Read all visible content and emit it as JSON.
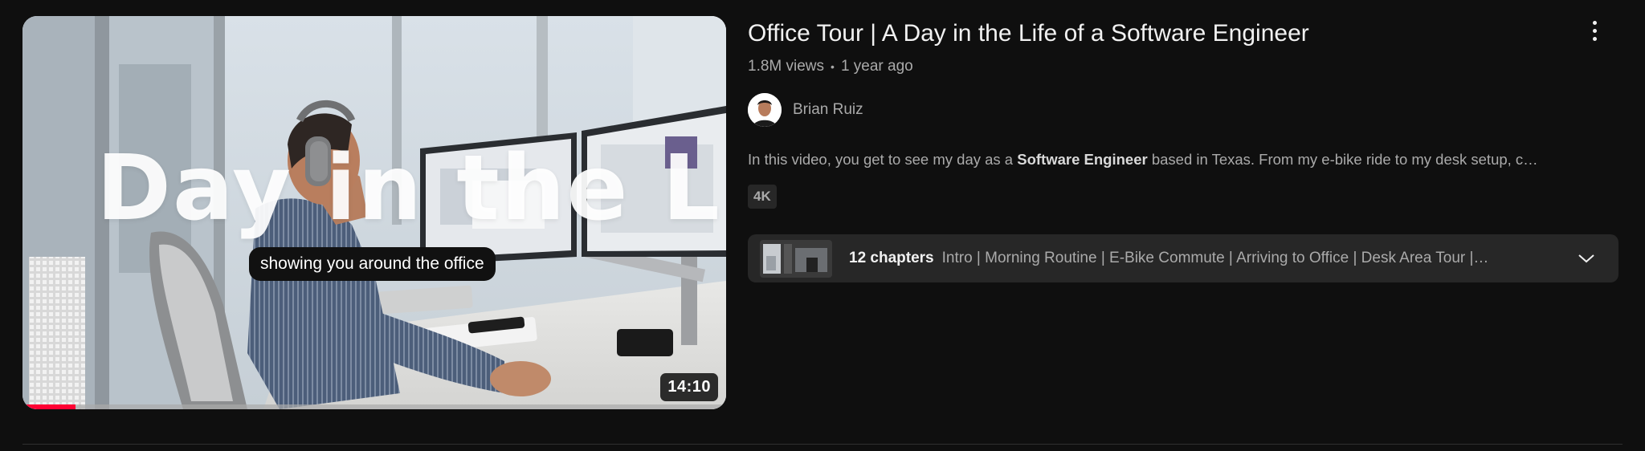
{
  "video": {
    "thumbnail": {
      "overlay_title": "Day in the Life",
      "caption": "showing you around the office",
      "duration": "14:10",
      "watch_progress": 0.075
    },
    "title": "Office Tour | A Day in the Life of a Software Engineer",
    "views": "1.8M views",
    "separator": "•",
    "age": "1 year ago",
    "channel": {
      "name": "Brian Ruiz",
      "avatar_icon": "channel-avatar"
    },
    "description": {
      "before": "In this video, you get to see my day as a ",
      "bold": "Software Engineer",
      "after": " based in Texas. From my e-bike ride to my desk setup, c…"
    },
    "badge": "4K",
    "chapters": {
      "count_label": "12 chapters",
      "list": "Intro | Morning Routine | E-Bike Commute | Arriving to Office | Desk Area Tour |…",
      "expand_icon": "chevron-down-icon"
    },
    "more_icon": "more-vertical-icon"
  },
  "colors": {
    "background": "#0f0f0f",
    "progress": "#ff0033",
    "text_primary": "#f1f1f1",
    "text_secondary": "#aaaaaa",
    "chip": "#272727"
  }
}
